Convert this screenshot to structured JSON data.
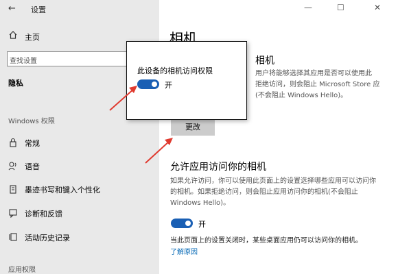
{
  "window": {
    "title": "设置",
    "minimize": "—",
    "maximize": "☐",
    "close": "✕"
  },
  "sidebar": {
    "home": "主页",
    "search_placeholder": "查找设置",
    "current": "隐私",
    "section_windows": "Windows 权限",
    "items": [
      {
        "label": "常规"
      },
      {
        "label": "语音"
      },
      {
        "label": "墨迹书写和键入个性化"
      },
      {
        "label": "诊断和反馈"
      },
      {
        "label": "活动历史记录"
      }
    ],
    "section_apps": "应用权限"
  },
  "main": {
    "title": "相机",
    "device_heading": "相机",
    "device_desc": [
      "用户将能够选择其应用是否可以使用此",
      "拒绝访问，则会阻止 Microsoft Store 应",
      "(不会阻止 Windows Hello)。"
    ],
    "device_state_frag": "",
    "change_button": "更改",
    "allow_heading": "允许应用访问你的相机",
    "allow_desc": [
      "如果允许访问，你可以使用此页面上的设置选择哪些应用可以访问你",
      "的相机。如果拒绝访问，则会阻止应用访问你的相机(不会阻止",
      "Windows Hello)。"
    ],
    "toggle_label": "开",
    "footer_text": "当此页面上的设置关闭时，某些桌面应用仍可以访问你的相机。",
    "link": "了解原因"
  },
  "popup": {
    "title": "此设备的相机访问权限",
    "toggle_label": "开"
  },
  "colors": {
    "accent": "#1a5fb4",
    "arrow": "#e03a2f",
    "link": "#0066b4"
  }
}
